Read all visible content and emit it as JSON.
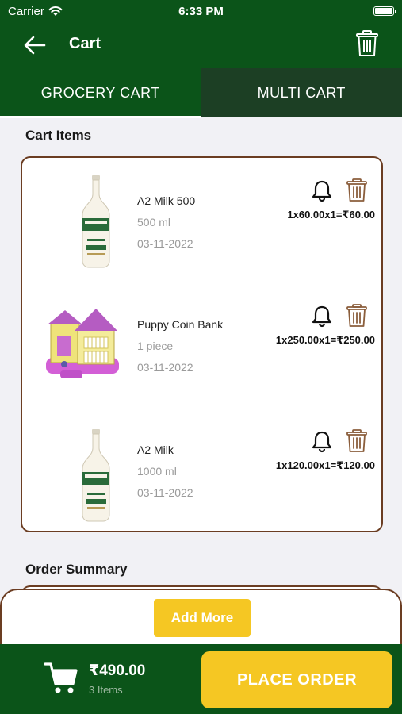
{
  "status": {
    "carrier": "Carrier",
    "time": "6:33 PM"
  },
  "header": {
    "title": "Cart"
  },
  "tabs": [
    {
      "label": "GROCERY CART",
      "active": true
    },
    {
      "label": "MULTI CART",
      "active": false
    }
  ],
  "cart": {
    "section_title": "Cart Items",
    "items": [
      {
        "name": "A2 Milk 500",
        "quantity": "500 ml",
        "date": "03-11-2022",
        "price_line": "1x60.00x1=₹60.00",
        "image": "milk-bottle"
      },
      {
        "name": "Puppy Coin Bank",
        "quantity": "1 piece",
        "date": "03-11-2022",
        "price_line": "1x250.00x1=₹250.00",
        "image": "coin-bank-house"
      },
      {
        "name": "A2 Milk",
        "quantity": "1000 ml",
        "date": "03-11-2022",
        "price_line": "1x120.00x1=₹120.00",
        "image": "milk-bottle"
      }
    ]
  },
  "order_summary": {
    "section_title": "Order Summary"
  },
  "actions": {
    "add_more_label": "Add More",
    "place_order_label": "PLACE ORDER"
  },
  "footer": {
    "total": "₹490.00",
    "items_count": "3 Items"
  },
  "colors": {
    "primary_green": "#0b5419",
    "accent_yellow": "#f5c723",
    "card_border": "#6b3d22"
  }
}
